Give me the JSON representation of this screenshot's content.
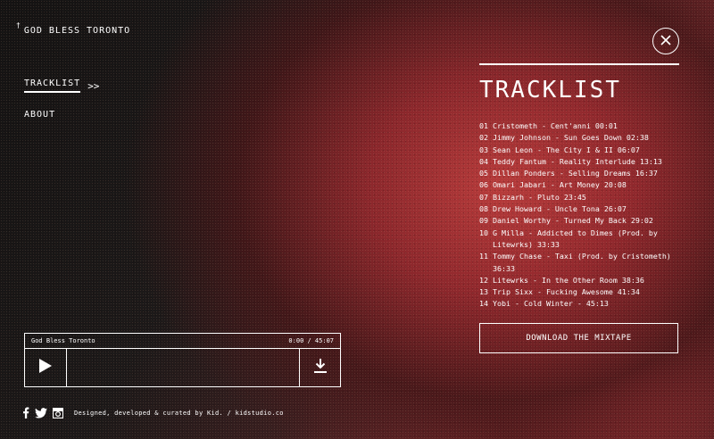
{
  "brand": {
    "dagger": "†",
    "title": "GOD BLESS TORONTO"
  },
  "nav": {
    "items": [
      {
        "label": "TRACKLIST",
        "suffix": ">>"
      },
      {
        "label": "ABOUT"
      }
    ]
  },
  "panel": {
    "title": "TRACKLIST",
    "tracks": [
      {
        "num": "01",
        "text": "Cristometh - Cent'anni 00:01"
      },
      {
        "num": "02",
        "text": "Jimmy Johnson - Sun Goes Down 02:38"
      },
      {
        "num": "03",
        "text": "Sean Leon - The City I & II 06:07"
      },
      {
        "num": "04",
        "text": "Teddy Fantum - Reality Interlude 13:13"
      },
      {
        "num": "05",
        "text": "Dillan Ponders - Selling Dreams 16:37"
      },
      {
        "num": "06",
        "text": "Omari Jabari - Art Money 20:08"
      },
      {
        "num": "07",
        "text": "Bizzarh - Pluto 23:45"
      },
      {
        "num": "08",
        "text": "Drew Howard - Uncle Tona 26:07"
      },
      {
        "num": "09",
        "text": "Daniel Worthy - Turned My Back 29:02"
      },
      {
        "num": "10",
        "text": "G Milla - Addicted to Dimes (Prod. by Litewrks) 33:33"
      },
      {
        "num": "11",
        "text": "Tommy Chase - Taxi (Prod. by Cristometh) 36:33"
      },
      {
        "num": "12",
        "text": "Litewrks - In the Other Room 38:36"
      },
      {
        "num": "13",
        "text": "Trip Sixx - Fucking Awesome 41:34"
      },
      {
        "num": "14",
        "text": "Yobi - Cold Winter - 45:13"
      }
    ],
    "download_label": "DOWNLOAD THE MIXTAPE"
  },
  "player": {
    "title": "God Bless Toronto",
    "time": "0:00 / 45:07",
    "progress": 0
  },
  "footer": {
    "credits": "Designed, developed & curated by Kid. / kidstudio.co",
    "social": [
      "facebook-icon",
      "twitter-icon",
      "instagram-icon"
    ]
  }
}
